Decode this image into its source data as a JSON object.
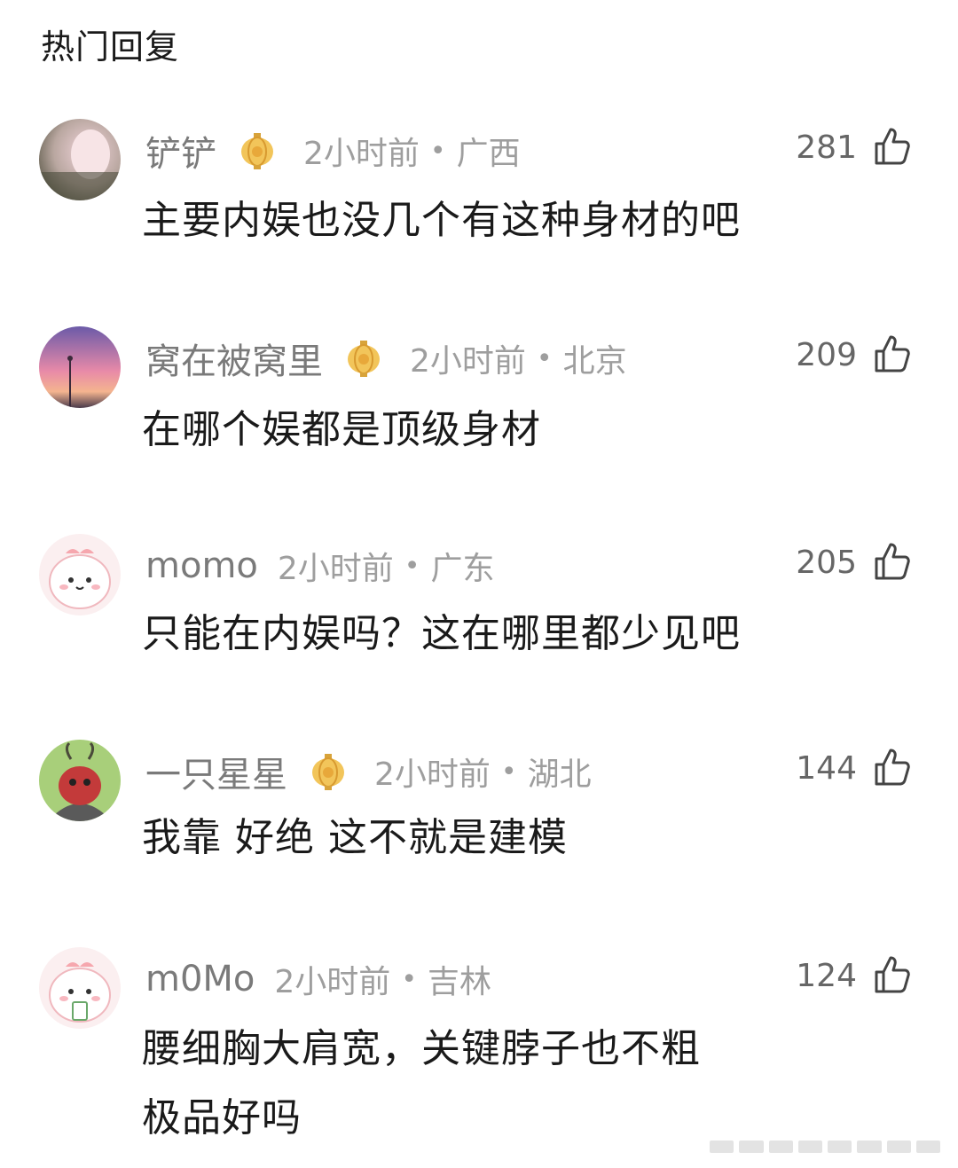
{
  "section_title": "热门回复",
  "comments": [
    {
      "username": "铲铲",
      "has_badge": true,
      "time": "2小时前",
      "region": "广西",
      "likes": "281",
      "content": [
        "主要内娱也没几个有这种身材的吧"
      ]
    },
    {
      "username": "窝在被窝里",
      "has_badge": true,
      "time": "2小时前",
      "region": "北京",
      "likes": "209",
      "content": [
        "在哪个娱都是顶级身材"
      ]
    },
    {
      "username": "momo",
      "has_badge": false,
      "time": "2小时前",
      "region": "广东",
      "likes": "205",
      "content": [
        "只能在内娱吗？这在哪里都少见吧"
      ]
    },
    {
      "username": "一只星星",
      "has_badge": true,
      "time": "2小时前",
      "region": "湖北",
      "likes": "144",
      "content": [
        "我靠 好绝 这不就是建模"
      ]
    },
    {
      "username": "m0Mo",
      "has_badge": false,
      "time": "2小时前",
      "region": "吉林",
      "likes": "124",
      "content": [
        "腰细胸大肩宽，关键脖子也不粗",
        "极品好吗"
      ]
    }
  ],
  "separator": "•",
  "icons": {
    "like": "thumbs-up-icon",
    "badge": "lantern-icon"
  }
}
